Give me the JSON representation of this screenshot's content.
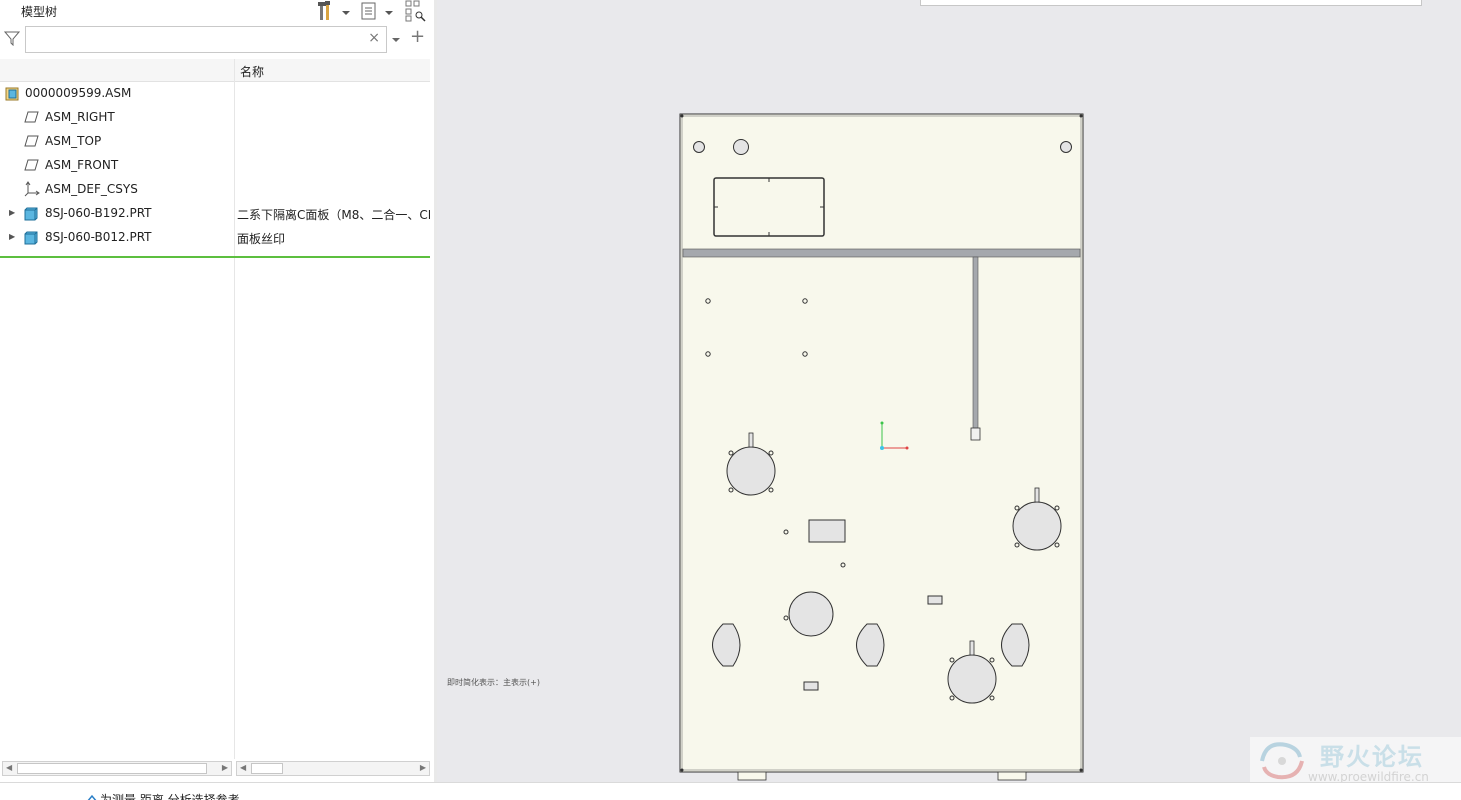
{
  "panel": {
    "title": "模型树",
    "search": {
      "value": "",
      "placeholder": ""
    },
    "clear_glyph": "×",
    "add_glyph": "+"
  },
  "tree": {
    "column_name": "名称",
    "rows": [
      {
        "label": "0000009599.ASM",
        "desc": "",
        "icon": "assembly-icon"
      },
      {
        "label": "ASM_RIGHT",
        "desc": "",
        "icon": "datum-plane-icon"
      },
      {
        "label": "ASM_TOP",
        "desc": "",
        "icon": "datum-plane-icon"
      },
      {
        "label": "ASM_FRONT",
        "desc": "",
        "icon": "datum-plane-icon"
      },
      {
        "label": "ASM_DEF_CSYS",
        "desc": "",
        "icon": "csys-icon"
      },
      {
        "label": "8SJ-060-B192.PRT",
        "desc": "二系下隔离C面板（M8、二合一、CI",
        "icon": "part-icon"
      },
      {
        "label": "8SJ-060-B012.PRT",
        "desc": "面板丝印",
        "icon": "part-icon"
      }
    ]
  },
  "graphics": {
    "overlay_text": "即时简化表示：主表示(+)"
  },
  "watermark": {
    "text": "野火论坛",
    "url": "www.proewildfire.cn"
  },
  "status": {
    "message": "为测量 距离 分析选择参考"
  },
  "colors": {
    "panel_fill": "#f8f8ec",
    "viewport_bg": "#e9e9ec",
    "selection_line": "#5cbf3f"
  }
}
